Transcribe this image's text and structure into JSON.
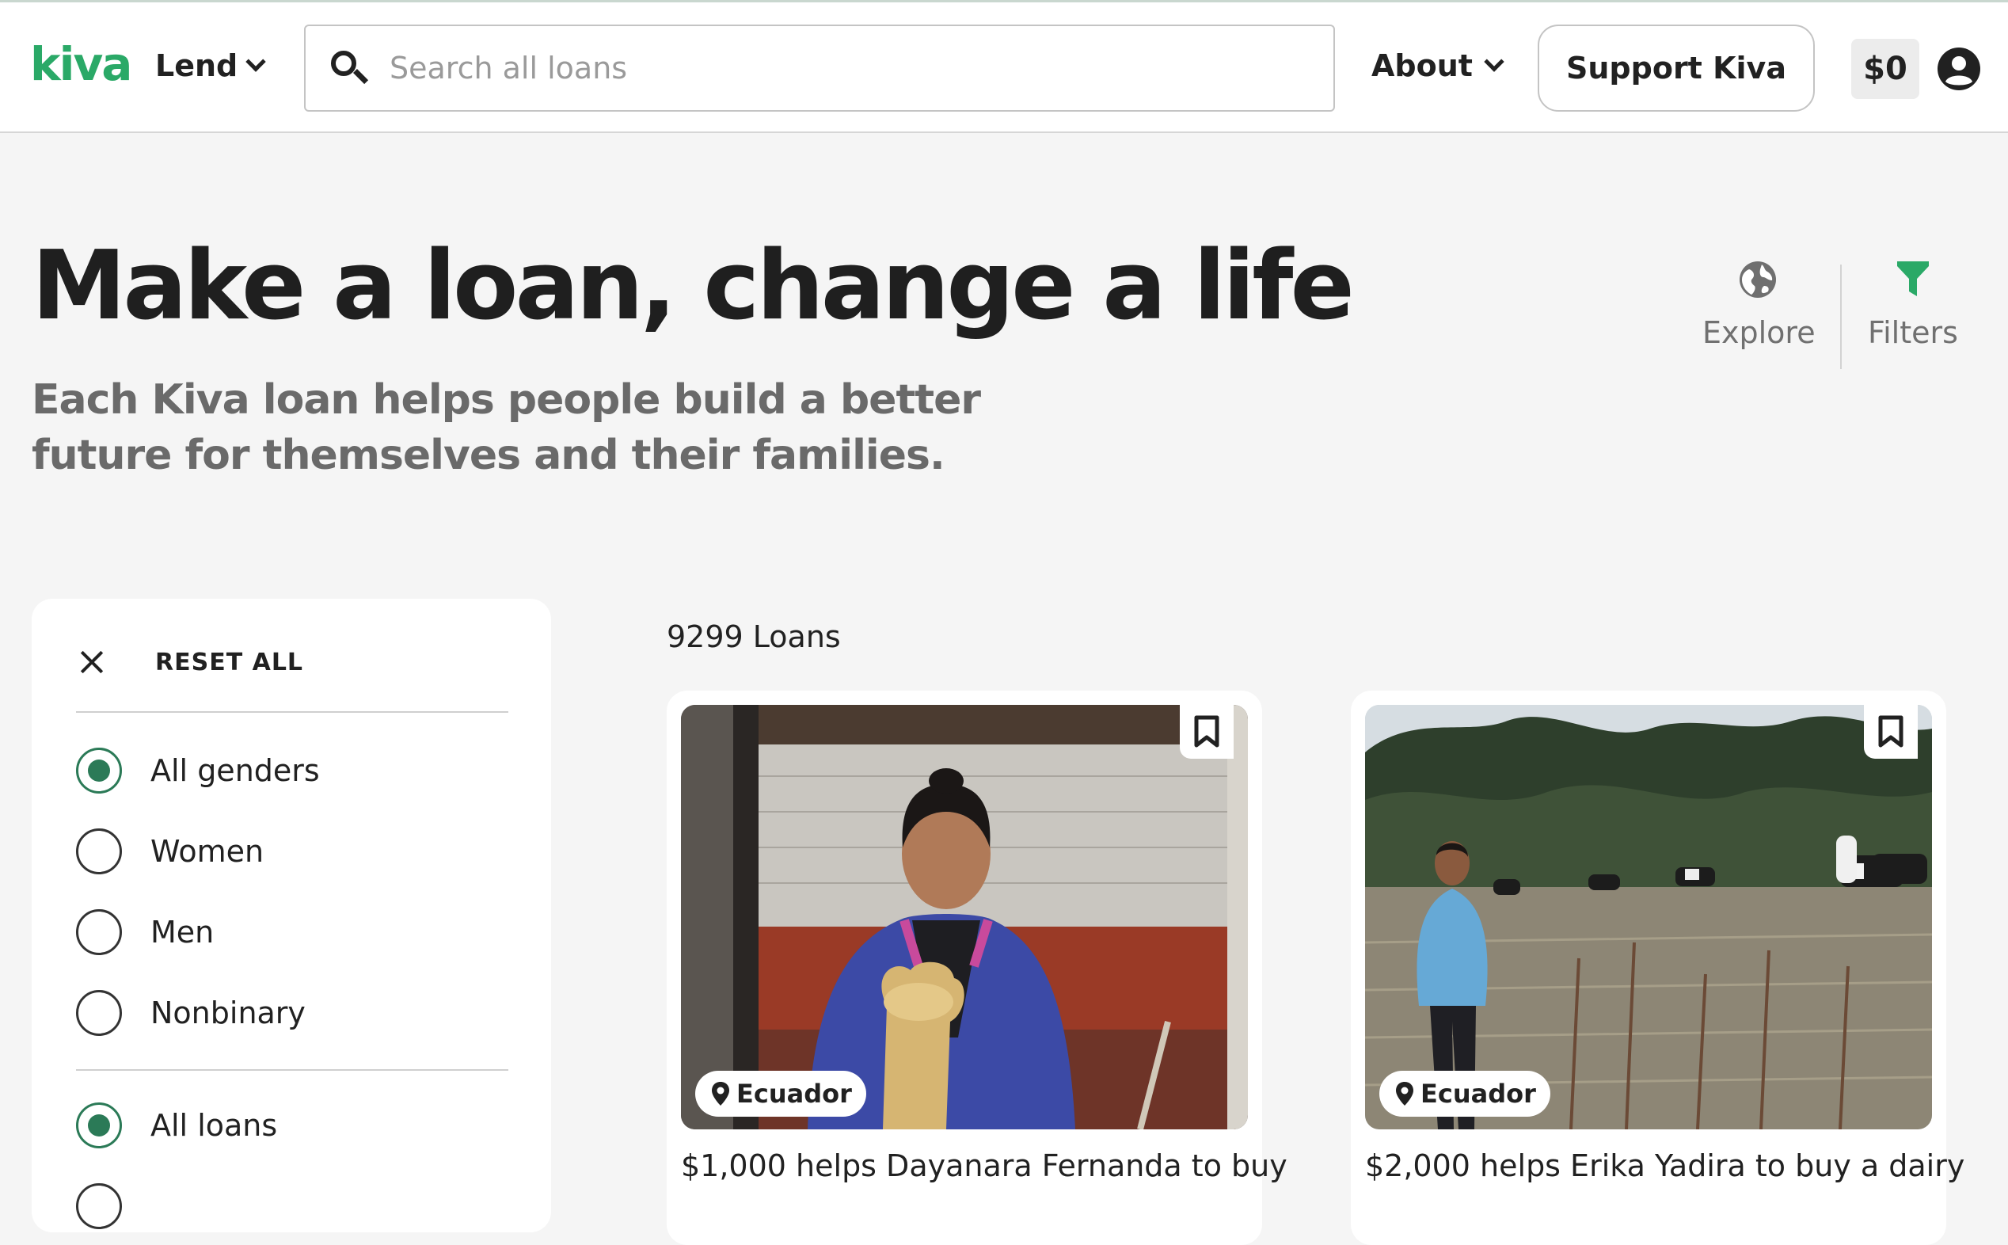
{
  "header": {
    "logo": "kiva",
    "lend_label": "Lend",
    "search_placeholder": "Search all loans",
    "about_label": "About",
    "support_label": "Support Kiva",
    "basket_amount": "$0"
  },
  "hero": {
    "title": "Make a loan, change a life",
    "subtitle": "Each Kiva loan helps people build a better future for themselves and their families."
  },
  "view_toggle": {
    "explore_label": "Explore",
    "filters_label": "Filters"
  },
  "filter_panel": {
    "reset_label": "RESET ALL",
    "gender_options": [
      {
        "label": "All genders",
        "selected": true
      },
      {
        "label": "Women",
        "selected": false
      },
      {
        "label": "Men",
        "selected": false
      },
      {
        "label": "Nonbinary",
        "selected": false
      }
    ],
    "loan_options": [
      {
        "label": "All loans",
        "selected": true
      }
    ]
  },
  "results": {
    "count_label": "9299 Loans"
  },
  "loans": [
    {
      "country": "Ecuador",
      "title": "$1,000 helps Dayanara Fernanda to buy"
    },
    {
      "country": "Ecuador",
      "title": "$2,000 helps Erika Yadira to buy a dairy"
    }
  ],
  "colors": {
    "brand_green": "#2aa967",
    "radio_green": "#2b7a57",
    "filter_icon_green": "#2aa967"
  }
}
